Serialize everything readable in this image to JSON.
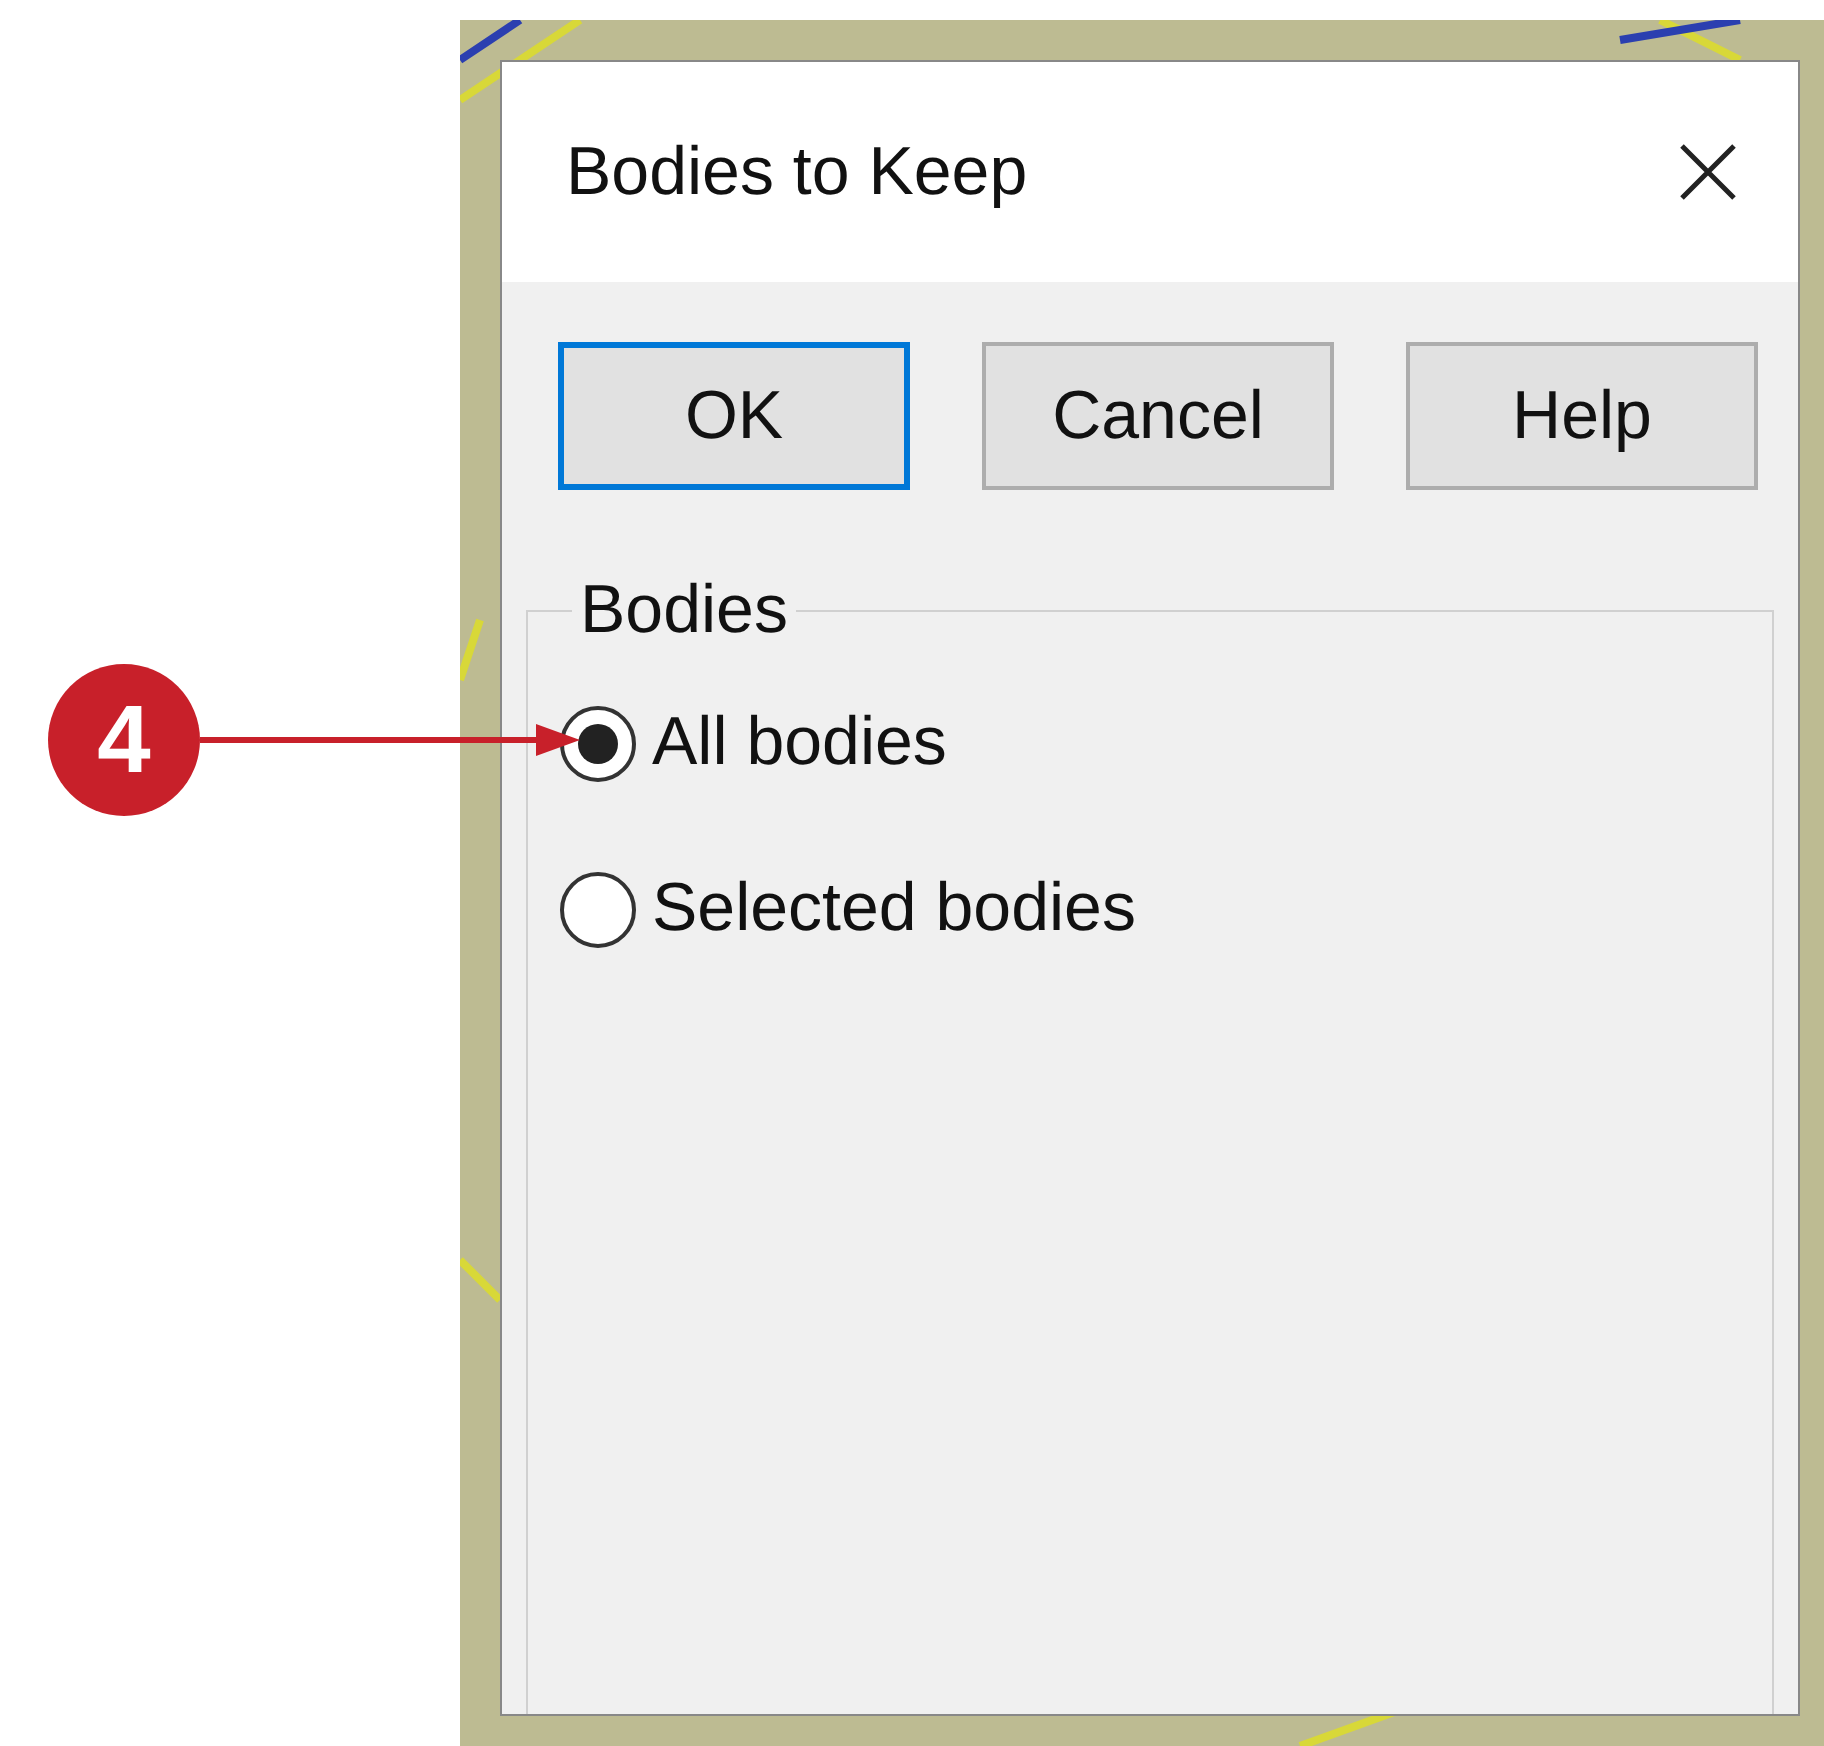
{
  "callout": {
    "number": "4"
  },
  "dialog": {
    "title": "Bodies to Keep",
    "buttons": [
      {
        "label": "OK",
        "default": true
      },
      {
        "label": "Cancel",
        "default": false
      },
      {
        "label": "Help",
        "default": false
      }
    ],
    "group": {
      "label": "Bodies",
      "options": [
        {
          "label": "All bodies",
          "selected": true
        },
        {
          "label": "Selected bodies",
          "selected": false
        }
      ]
    }
  }
}
